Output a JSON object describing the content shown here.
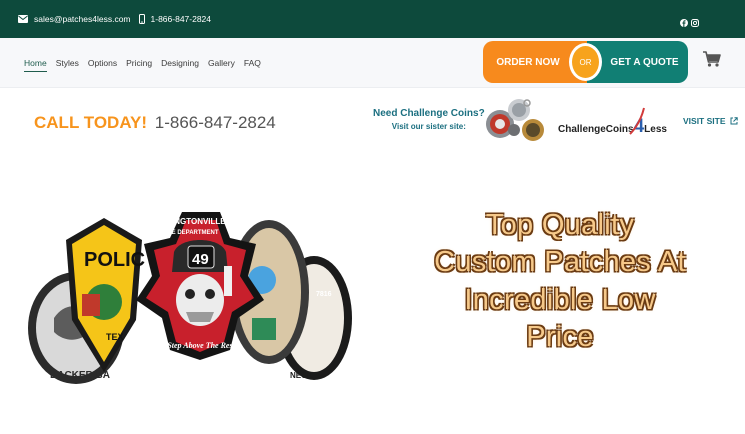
{
  "topbar": {
    "email": "sales@patches4less.com",
    "phone": "1-866-847-2824",
    "icons": [
      "envelope-icon",
      "mobile-phone-icon",
      "facebook-icon",
      "instagram-icon"
    ]
  },
  "nav": {
    "items": [
      "Home",
      "Styles",
      "Options",
      "Pricing",
      "Designing",
      "Gallery",
      "FAQ"
    ],
    "active": "Home"
  },
  "cta": {
    "order_label": "ORDER NOW",
    "or_label": "OR",
    "quote_label": "GET A QUOTE"
  },
  "call": {
    "label": "CALL TODAY!",
    "number": "1-866-847-2824"
  },
  "sister": {
    "question": "Need Challenge Coins?",
    "visit_text": "Visit our sister site:",
    "brand_prefix": "ChallengeCoins",
    "brand_four": "4",
    "brand_suffix": "Less",
    "visit_label": "VISIT SITE"
  },
  "hero": {
    "line1": "Top Quality",
    "line2": "Custom Patches At",
    "line3": "Incredible Low",
    "line4": "Price"
  },
  "patches": {
    "main_top": "WASHINGTONVILLE",
    "main_sub": "FIRE DEPARTMENT",
    "main_number": "49",
    "main_motto": "\"A Step Above The Rest\"",
    "police": "POLIC",
    "police_bottom": "TEX",
    "left": "BACKER BA",
    "right_num": "7816",
    "right_bottom": "NECK"
  },
  "colors": {
    "topbar_bg": "#0d4a3c",
    "order_orange": "#f78a1d",
    "quote_teal": "#117f74",
    "call_orange": "#f7941d",
    "sister_teal": "#1b6f80",
    "hero_text": "#f6c98a"
  }
}
